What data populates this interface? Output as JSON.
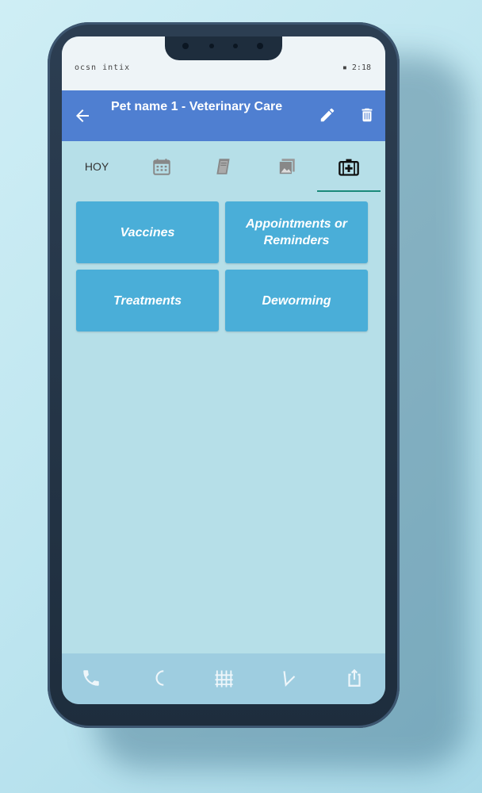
{
  "status_bar": {
    "left_text": "ocsn intix",
    "right_text": "▪ 2:18"
  },
  "app_bar": {
    "title": "Pet name 1 - Veterinary Care",
    "back_icon": "arrow-left-icon",
    "edit_icon": "pencil-icon",
    "delete_icon": "trash-icon"
  },
  "tabs": {
    "today_label": "HOY",
    "items": [
      "calendar-icon",
      "book-icon",
      "gallery-icon",
      "medical-kit-icon"
    ],
    "active_index": 4
  },
  "cards": {
    "vaccines": "Vaccines",
    "appointments": "Appointments or Reminders",
    "treatments": "Treatments",
    "deworming": "Deworming"
  },
  "bottom_nav": [
    "phone-icon",
    "moon-icon",
    "grid-icon",
    "pen-icon",
    "share-icon"
  ],
  "colors": {
    "app_bar": "#4f7fd1",
    "card": "#4aaed8",
    "screen": "#b6dfe8",
    "tab_indicator": "#1a8a7a"
  }
}
